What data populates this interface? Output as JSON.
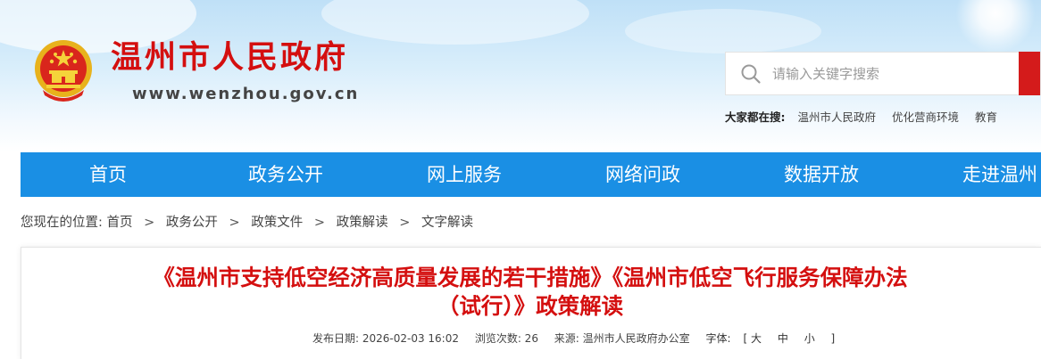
{
  "header": {
    "site_title": "温州市人民政府",
    "site_url": "www.wenzhou.gov.cn",
    "emblem_icon": "national-emblem-icon"
  },
  "search": {
    "placeholder": "请输入关键字搜索",
    "icon": "search-icon",
    "button_color": "#d41b1b"
  },
  "hot_search": {
    "label": "大家都在搜:",
    "items": [
      "温州市人民政府",
      "优化营商环境",
      "教育"
    ]
  },
  "nav": {
    "color": "#1a8fe4",
    "items": [
      "首页",
      "政务公开",
      "网上服务",
      "网络问政",
      "数据开放",
      "走进温州"
    ]
  },
  "breadcrumb": {
    "prefix": "您现在的位置:",
    "items": [
      "首页",
      "政务公开",
      "政策文件",
      "政策解读",
      "文字解读"
    ],
    "separator": ">"
  },
  "article": {
    "title_line1": "《温州市支持低空经济高质量发展的若干措施》《温州市低空飞行服务保障办法",
    "title_line2": "（试行）》政策解读",
    "publish_date": "发布日期: 2026-02-03 16:02",
    "views": "浏览次数: 26",
    "source": "来源: 温州市人民政府办公室",
    "font_size": "字体: [ 大 中 小 ]",
    "font_size_label": "字体:",
    "font_size_options": [
      "大",
      "中",
      "小"
    ]
  }
}
